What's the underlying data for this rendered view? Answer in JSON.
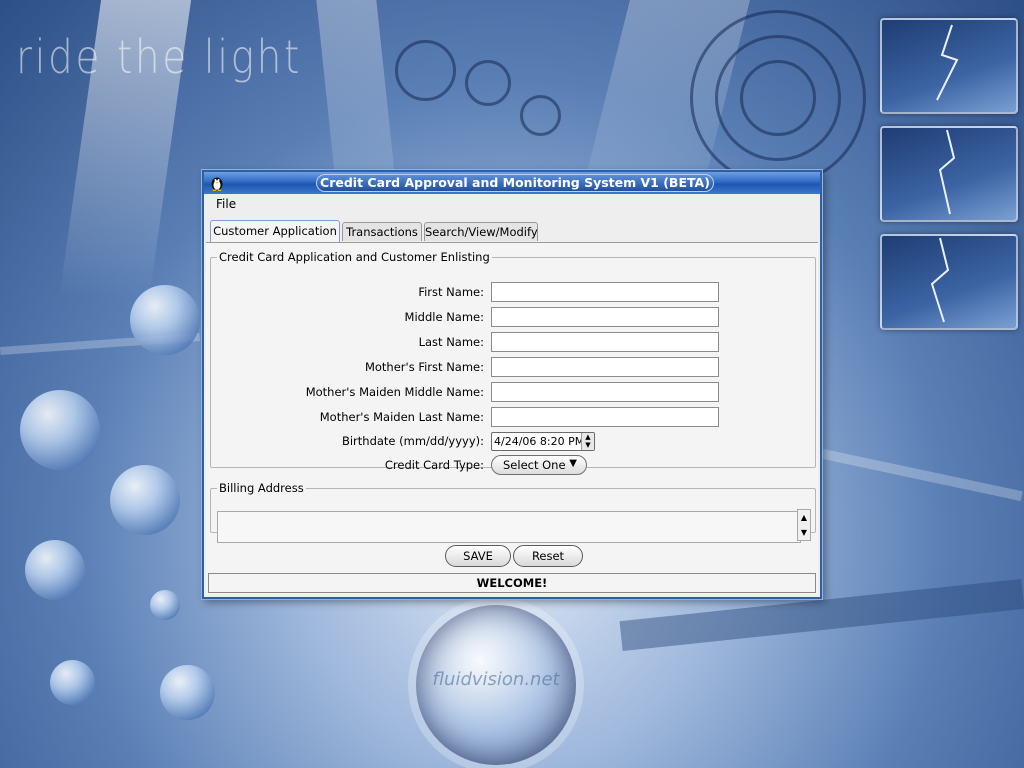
{
  "wallpaper": {
    "title": "ride the light",
    "watermark": "fluidvision.net"
  },
  "window": {
    "title": "Credit Card Approval and Monitoring System V1 (BETA)",
    "app_icon": "penguin-icon"
  },
  "menu": {
    "file_label": "File"
  },
  "tabs": [
    {
      "label": "Customer Application",
      "active": true
    },
    {
      "label": "Transactions",
      "active": false
    },
    {
      "label": "Search/View/Modify",
      "active": false
    }
  ],
  "application_group": {
    "legend": "Credit Card Application and Customer Enlisting",
    "fields": {
      "first_name": {
        "label": "First Name:",
        "value": ""
      },
      "middle_name": {
        "label": "Middle Name:",
        "value": ""
      },
      "last_name": {
        "label": "Last Name:",
        "value": ""
      },
      "mother_first_name": {
        "label": "Mother's First Name:",
        "value": ""
      },
      "mother_maiden_middle_name": {
        "label": "Mother's Maiden Middle Name:",
        "value": ""
      },
      "mother_maiden_last_name": {
        "label": "Mother's Maiden Last Name:",
        "value": ""
      }
    },
    "birthdate": {
      "label": "Birthdate (mm/dd/yyyy):",
      "value": "4/24/06 8:20 PM"
    },
    "card_type": {
      "label": "Credit Card Type:",
      "value": "Select One"
    }
  },
  "billing_group": {
    "legend": "Billing Address",
    "value": ""
  },
  "buttons": {
    "save_label": "SAVE",
    "reset_label": "Reset"
  },
  "status": {
    "message": "WELCOME!"
  },
  "colors": {
    "titlebar": "#2e6ac4",
    "window_border": "#2d5fa8",
    "window_bg": "#eeeeee"
  }
}
